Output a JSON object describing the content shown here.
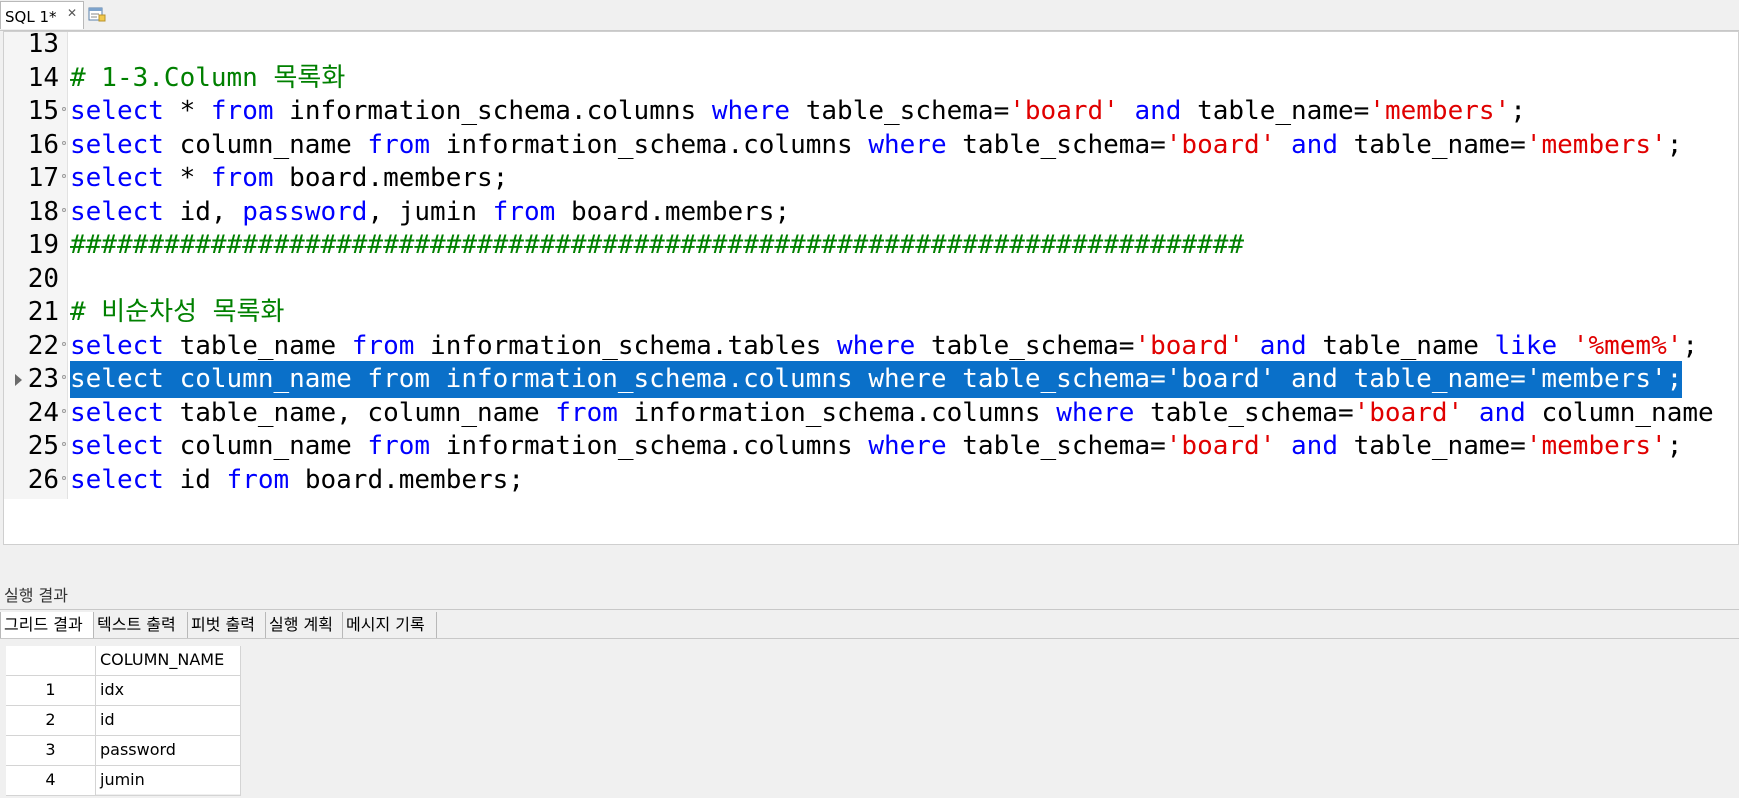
{
  "tabbar": {
    "tab_label": "SQL 1*",
    "close_icon": "close-icon",
    "new_query_icon": "new-query-icon"
  },
  "editor": {
    "lines": [
      {
        "num": "13",
        "segments": []
      },
      {
        "num": "14",
        "segments": [
          {
            "t": "# 1-3.Column 목록화",
            "c": "cmt"
          }
        ]
      },
      {
        "num": "15",
        "segments": [
          {
            "t": "select",
            "c": "kw"
          },
          {
            "t": " * ",
            "c": ""
          },
          {
            "t": "from",
            "c": "kw"
          },
          {
            "t": " information_schema.columns ",
            "c": ""
          },
          {
            "t": "where",
            "c": "kw"
          },
          {
            "t": " table_schema=",
            "c": ""
          },
          {
            "t": "'board'",
            "c": "str"
          },
          {
            "t": " ",
            "c": ""
          },
          {
            "t": "and",
            "c": "kw"
          },
          {
            "t": " table_name=",
            "c": ""
          },
          {
            "t": "'members'",
            "c": "str"
          },
          {
            "t": ";",
            "c": ""
          }
        ]
      },
      {
        "num": "16",
        "segments": [
          {
            "t": "select",
            "c": "kw"
          },
          {
            "t": " column_name ",
            "c": ""
          },
          {
            "t": "from",
            "c": "kw"
          },
          {
            "t": " information_schema.columns ",
            "c": ""
          },
          {
            "t": "where",
            "c": "kw"
          },
          {
            "t": " table_schema=",
            "c": ""
          },
          {
            "t": "'board'",
            "c": "str"
          },
          {
            "t": " ",
            "c": ""
          },
          {
            "t": "and",
            "c": "kw"
          },
          {
            "t": " table_name=",
            "c": ""
          },
          {
            "t": "'members'",
            "c": "str"
          },
          {
            "t": ";",
            "c": ""
          }
        ]
      },
      {
        "num": "17",
        "segments": [
          {
            "t": "select",
            "c": "kw"
          },
          {
            "t": " * ",
            "c": ""
          },
          {
            "t": "from",
            "c": "kw"
          },
          {
            "t": " board.members;",
            "c": ""
          }
        ]
      },
      {
        "num": "18",
        "segments": [
          {
            "t": "select",
            "c": "kw"
          },
          {
            "t": " id, ",
            "c": ""
          },
          {
            "t": "password",
            "c": "kw"
          },
          {
            "t": ", jumin ",
            "c": ""
          },
          {
            "t": "from",
            "c": "kw"
          },
          {
            "t": " board.members;",
            "c": ""
          }
        ]
      },
      {
        "num": "19",
        "segments": [
          {
            "t": "###########################################################################",
            "c": "cmt"
          }
        ]
      },
      {
        "num": "20",
        "segments": []
      },
      {
        "num": "21",
        "segments": [
          {
            "t": "# 비순차성 목록화",
            "c": "cmt"
          }
        ]
      },
      {
        "num": "22",
        "segments": [
          {
            "t": "select",
            "c": "kw"
          },
          {
            "t": " table_name ",
            "c": ""
          },
          {
            "t": "from",
            "c": "kw"
          },
          {
            "t": " information_schema.tables ",
            "c": ""
          },
          {
            "t": "where",
            "c": "kw"
          },
          {
            "t": " table_schema=",
            "c": ""
          },
          {
            "t": "'board'",
            "c": "str"
          },
          {
            "t": " ",
            "c": ""
          },
          {
            "t": "and",
            "c": "kw"
          },
          {
            "t": " table_name ",
            "c": ""
          },
          {
            "t": "like",
            "c": "kw"
          },
          {
            "t": " ",
            "c": ""
          },
          {
            "t": "'%mem%'",
            "c": "str"
          },
          {
            "t": ";",
            "c": ""
          }
        ]
      },
      {
        "num": "23",
        "selected": true,
        "segments": [
          {
            "t": "select column_name from information_schema.columns where table_schema='board' and table_name='members';",
            "c": ""
          }
        ]
      },
      {
        "num": "24",
        "segments": [
          {
            "t": "select",
            "c": "kw"
          },
          {
            "t": " table_name, column_name ",
            "c": ""
          },
          {
            "t": "from",
            "c": "kw"
          },
          {
            "t": " information_schema.columns ",
            "c": ""
          },
          {
            "t": "where",
            "c": "kw"
          },
          {
            "t": " table_schema=",
            "c": ""
          },
          {
            "t": "'board'",
            "c": "str"
          },
          {
            "t": " ",
            "c": ""
          },
          {
            "t": "and",
            "c": "kw"
          },
          {
            "t": " column_name",
            "c": ""
          }
        ]
      },
      {
        "num": "25",
        "segments": [
          {
            "t": "select",
            "c": "kw"
          },
          {
            "t": " column_name ",
            "c": ""
          },
          {
            "t": "from",
            "c": "kw"
          },
          {
            "t": " information_schema.columns ",
            "c": ""
          },
          {
            "t": "where",
            "c": "kw"
          },
          {
            "t": " table_schema=",
            "c": ""
          },
          {
            "t": "'board'",
            "c": "str"
          },
          {
            "t": " ",
            "c": ""
          },
          {
            "t": "and",
            "c": "kw"
          },
          {
            "t": " table_name=",
            "c": ""
          },
          {
            "t": "'members'",
            "c": "str"
          },
          {
            "t": ";",
            "c": ""
          }
        ]
      },
      {
        "num": "26",
        "segments": [
          {
            "t": "select",
            "c": "kw"
          },
          {
            "t": " id ",
            "c": ""
          },
          {
            "t": "from",
            "c": "kw"
          },
          {
            "t": " board.members;",
            "c": ""
          }
        ]
      }
    ],
    "scroll_left_arrow": "‹"
  },
  "results": {
    "title": "실행 결과",
    "tabs": [
      "그리드 결과",
      "텍스트 출력",
      "피벗 출력",
      "실행 계획",
      "메시지 기록"
    ],
    "grid": {
      "header": "COLUMN_NAME",
      "rows": [
        {
          "n": "1",
          "v": "idx"
        },
        {
          "n": "2",
          "v": "id"
        },
        {
          "n": "3",
          "v": "password"
        },
        {
          "n": "4",
          "v": "jumin"
        }
      ]
    }
  },
  "colors": {
    "keyword": "#0000ff",
    "string": "#e00000",
    "comment": "#008000",
    "selection": "#0a70c9"
  }
}
